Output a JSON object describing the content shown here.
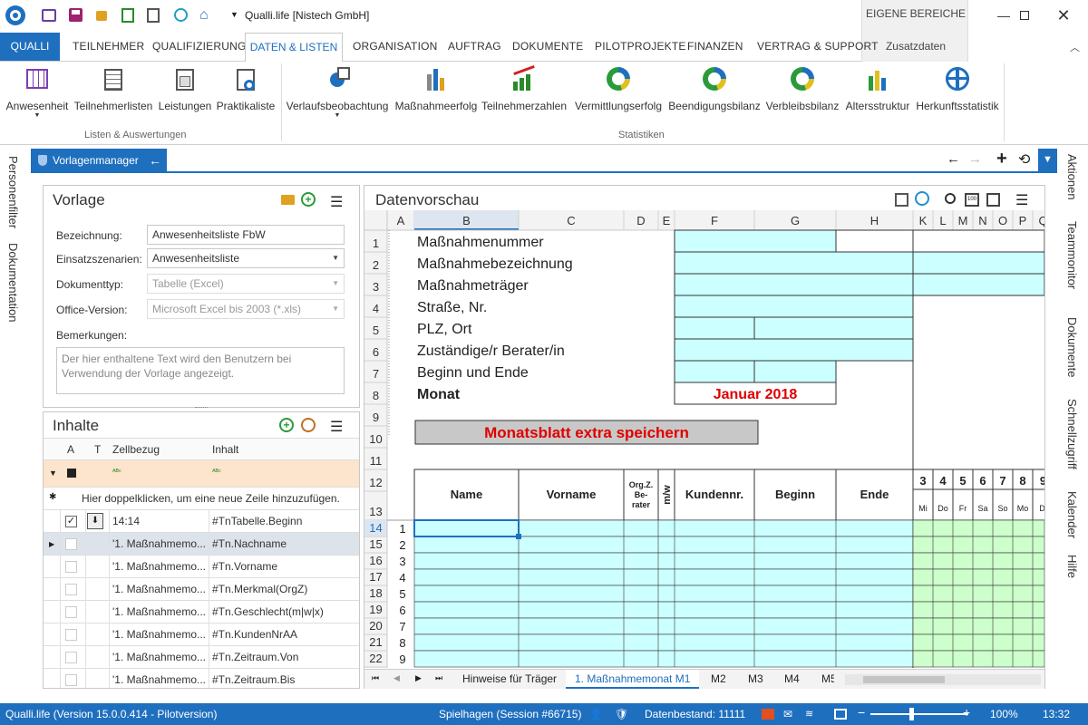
{
  "window": {
    "title": "Qualli.life [Nistech GmbH]",
    "eigene_bereiche": "EIGENE BEREICHE",
    "zusatzdaten": "Zusatzdaten"
  },
  "tabs": [
    "QUALLI",
    "TEILNEHMER",
    "QUALIFIZIERUNG",
    "DATEN & LISTEN",
    "ORGANISATION",
    "AUFTRAG",
    "DOKUMENTE",
    "PILOTPROJEKTE",
    "FINANZEN",
    "VERTRAG & SUPPORT"
  ],
  "ribbon": {
    "listen": [
      "Anwesenheit",
      "Teilnehmerlisten",
      "Leistungen",
      "Praktikaliste"
    ],
    "listen_group": "Listen & Auswertungen",
    "statistiken": [
      "Verlaufsbeobachtung",
      "Maßnahmeerfolg",
      "Teilnehmerzahlen",
      "Vermittlungserfolg",
      "Beendigungsbilanz",
      "Verbleibsbilanz",
      "Altersstruktur",
      "Herkunftsstatistik"
    ],
    "statistik_group": "Statistiken"
  },
  "left_side": [
    "Personenfilter",
    "Dokumentation"
  ],
  "right_side": [
    "Aktionen",
    "Teammonitor",
    "Dokumente",
    "Schnellzugriff",
    "Kalender",
    "Hilfe"
  ],
  "vorlagenmanager": "Vorlagenmanager",
  "vorlage": {
    "title": "Vorlage",
    "bezeichnung_label": "Bezeichnung:",
    "bezeichnung": "Anwesenheitsliste FbW",
    "einsatz_label": "Einsatzszenarien:",
    "einsatz": "Anwesenheitsliste",
    "doktyp_label": "Dokumenttyp:",
    "doktyp": "Tabelle (Excel)",
    "office_label": "Office-Version:",
    "office": "Microsoft Excel bis 2003 (*.xls)",
    "bemerk_label": "Bemerkungen:",
    "bemerk_placeholder": "Der hier enthaltene Text wird den Benutzern bei Verwendung der Vorlage angezeigt."
  },
  "inhalte": {
    "title": "Inhalte",
    "headers": [
      "A",
      "T",
      "Zellbezug",
      "Inhalt"
    ],
    "new_row_hint": "Hier doppelklicken, um eine neue Zeile hinzuzufügen.",
    "rows": [
      {
        "zell": "14:14",
        "inhalt": "#TnTabelle.Beginn"
      },
      {
        "zell": "'1. Maßnahmemo...",
        "inhalt": "#Tn.Nachname"
      },
      {
        "zell": "'1. Maßnahmemo...",
        "inhalt": "#Tn.Vorname"
      },
      {
        "zell": "'1. Maßnahmemo...",
        "inhalt": "#Tn.Merkmal(OrgZ)"
      },
      {
        "zell": "'1. Maßnahmemo...",
        "inhalt": "#Tn.Geschlecht(m|w|x)"
      },
      {
        "zell": "'1. Maßnahmemo...",
        "inhalt": "#Tn.KundenNrAA"
      },
      {
        "zell": "'1. Maßnahmemo...",
        "inhalt": "#Tn.Zeitraum.Von"
      },
      {
        "zell": "'1. Maßnahmemo...",
        "inhalt": "#Tn.Zeitraum.Bis"
      }
    ]
  },
  "datenvorschau": {
    "title": "Datenvorschau",
    "cols": [
      "A",
      "B",
      "C",
      "D",
      "E",
      "F",
      "G",
      "H",
      "K",
      "L",
      "M",
      "N",
      "O",
      "P",
      "Q"
    ],
    "rows": [
      "1",
      "2",
      "3",
      "4",
      "5",
      "6",
      "7",
      "8",
      "9",
      "10",
      "11",
      "12",
      "13",
      "14",
      "15",
      "16",
      "17",
      "18",
      "19",
      "20",
      "21",
      "22"
    ],
    "labels": [
      "Maßnahmenummer",
      "Maßnahmebezeichnung",
      "Maßnahmeträger",
      "Straße, Nr.",
      "PLZ, Ort",
      "Zuständige/r Berater/in",
      "Beginn und Ende",
      "Monat"
    ],
    "monat_value": "Januar 2018",
    "button": "Monatsblatt extra speichern",
    "table_headers": [
      "Name",
      "Vorname",
      "Org.Z. Be- rater",
      "m/w",
      "Kundennr.",
      "Beginn",
      "Ende"
    ],
    "day_nums": [
      "3",
      "4",
      "5",
      "6",
      "7",
      "8",
      "9"
    ],
    "day_names": [
      "Mi",
      "Do",
      "Fr",
      "Sa",
      "So",
      "Mo",
      "Di"
    ],
    "tn_nums": [
      "1",
      "2",
      "3",
      "4",
      "5",
      "6",
      "7",
      "8",
      "9"
    ],
    "sheet_tabs": [
      "Hinweise für Träger",
      "1. Maßnahmemonat M1",
      "M2",
      "M3",
      "M4",
      "M5"
    ]
  },
  "status": {
    "version": "Qualli.life (Version 15.0.0.414 - Pilotversion)",
    "session": "Spielhagen (Session #66715)",
    "datenbestand": "Datenbestand: 11111",
    "zoom": "100%",
    "time": "13:32"
  }
}
